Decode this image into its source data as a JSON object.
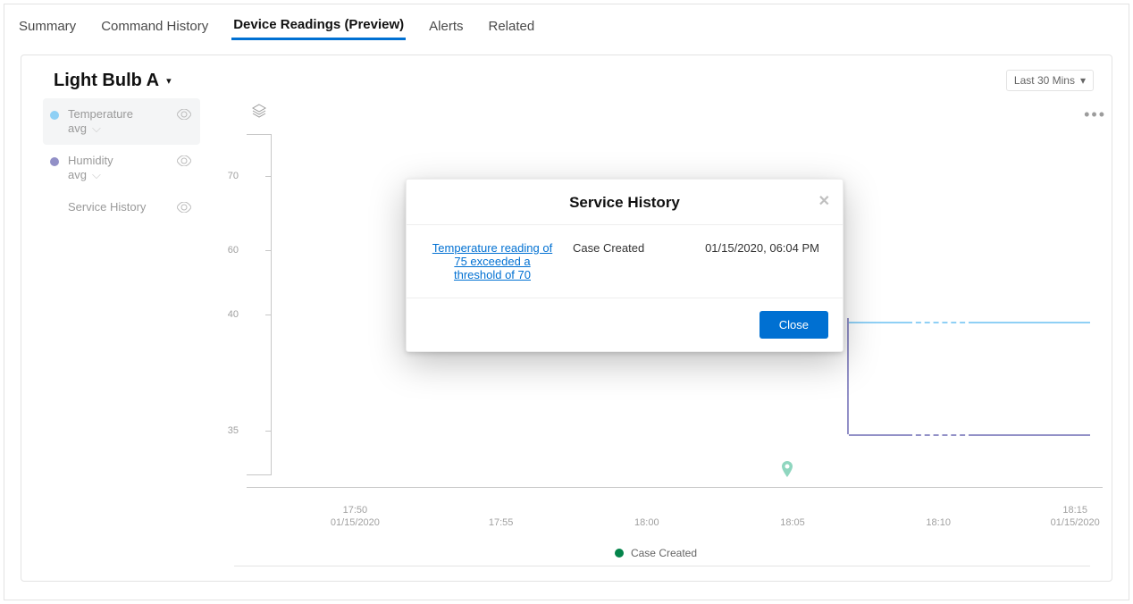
{
  "tabs": [
    {
      "label": "Summary"
    },
    {
      "label": "Command History"
    },
    {
      "label": "Device Readings (Preview)",
      "active": true
    },
    {
      "label": "Alerts"
    },
    {
      "label": "Related"
    }
  ],
  "device_title": "Light Bulb A",
  "range": {
    "label": "Last 30 Mins"
  },
  "legend": {
    "items": [
      {
        "name": "Temperature",
        "agg": "avg",
        "color": "#8fd0f5"
      },
      {
        "name": "Humidity",
        "agg": "avg",
        "color": "#9290c7"
      },
      {
        "name": "Service History"
      }
    ]
  },
  "chart_data": {
    "type": "line",
    "x_ticks": [
      {
        "time": "17:50",
        "date": "01/15/2020"
      },
      {
        "time": "17:55"
      },
      {
        "time": "18:00"
      },
      {
        "time": "18:05"
      },
      {
        "time": "18:10"
      },
      {
        "time": "18:15",
        "date": "01/15/2020"
      }
    ],
    "y_ticks": [
      35,
      40,
      60,
      70
    ],
    "ylim": [
      30,
      75
    ],
    "series": [
      {
        "name": "Temperature",
        "color": "#8fd0f5",
        "points": [
          {
            "x": "18:07",
            "y": 45
          },
          {
            "x": "18:15",
            "y": 45
          }
        ]
      },
      {
        "name": "Humidity",
        "color": "#9290c7",
        "points": [
          {
            "x": "18:07",
            "y": 45
          },
          {
            "x": "18:07",
            "y": 33
          },
          {
            "x": "18:15",
            "y": 33
          }
        ]
      }
    ],
    "event_marker": {
      "label": "Case Created",
      "x": "18:04",
      "icon": "pin",
      "color": "#8fd6bf"
    },
    "footer_legend": {
      "label": "Case Created",
      "color": "#04844b"
    }
  },
  "modal": {
    "title": "Service History",
    "link_text": "Temperature reading of 75 exceeded a threshold of 70",
    "status": "Case Created",
    "datetime": "01/15/2020, 06:04 PM",
    "close_btn": "Close"
  }
}
